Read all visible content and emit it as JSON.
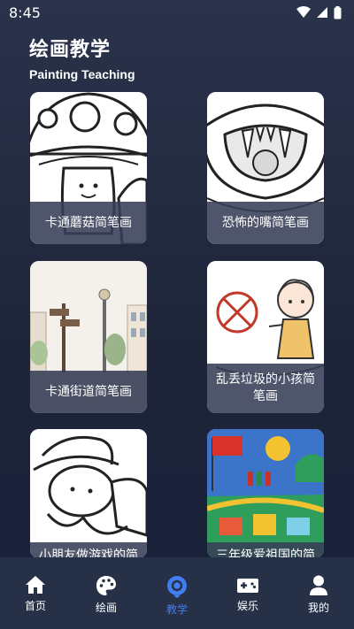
{
  "status_bar": {
    "time": "8:45"
  },
  "header": {
    "title_cn": "绘画教学",
    "title_en": "Painting Teaching"
  },
  "cards": [
    {
      "caption": "卡通蘑菇简笔画"
    },
    {
      "caption": "恐怖的嘴简笔画"
    },
    {
      "caption": "卡通街道简笔画"
    },
    {
      "caption": "乱丢垃圾的小孩简笔画"
    },
    {
      "caption": "小朋友做游戏的简笔画"
    },
    {
      "caption": "三年级爱祖国的简笔画"
    }
  ],
  "tabs": [
    {
      "label": "首页",
      "icon": "home-icon"
    },
    {
      "label": "绘画",
      "icon": "palette-icon"
    },
    {
      "label": "教学",
      "icon": "location-pin-icon",
      "active": true
    },
    {
      "label": "娱乐",
      "icon": "gamepad-icon"
    },
    {
      "label": "我的",
      "icon": "person-icon"
    }
  ],
  "colors": {
    "accent": "#3f7df0",
    "background": "#1e2539",
    "tabbar": "#263047"
  }
}
